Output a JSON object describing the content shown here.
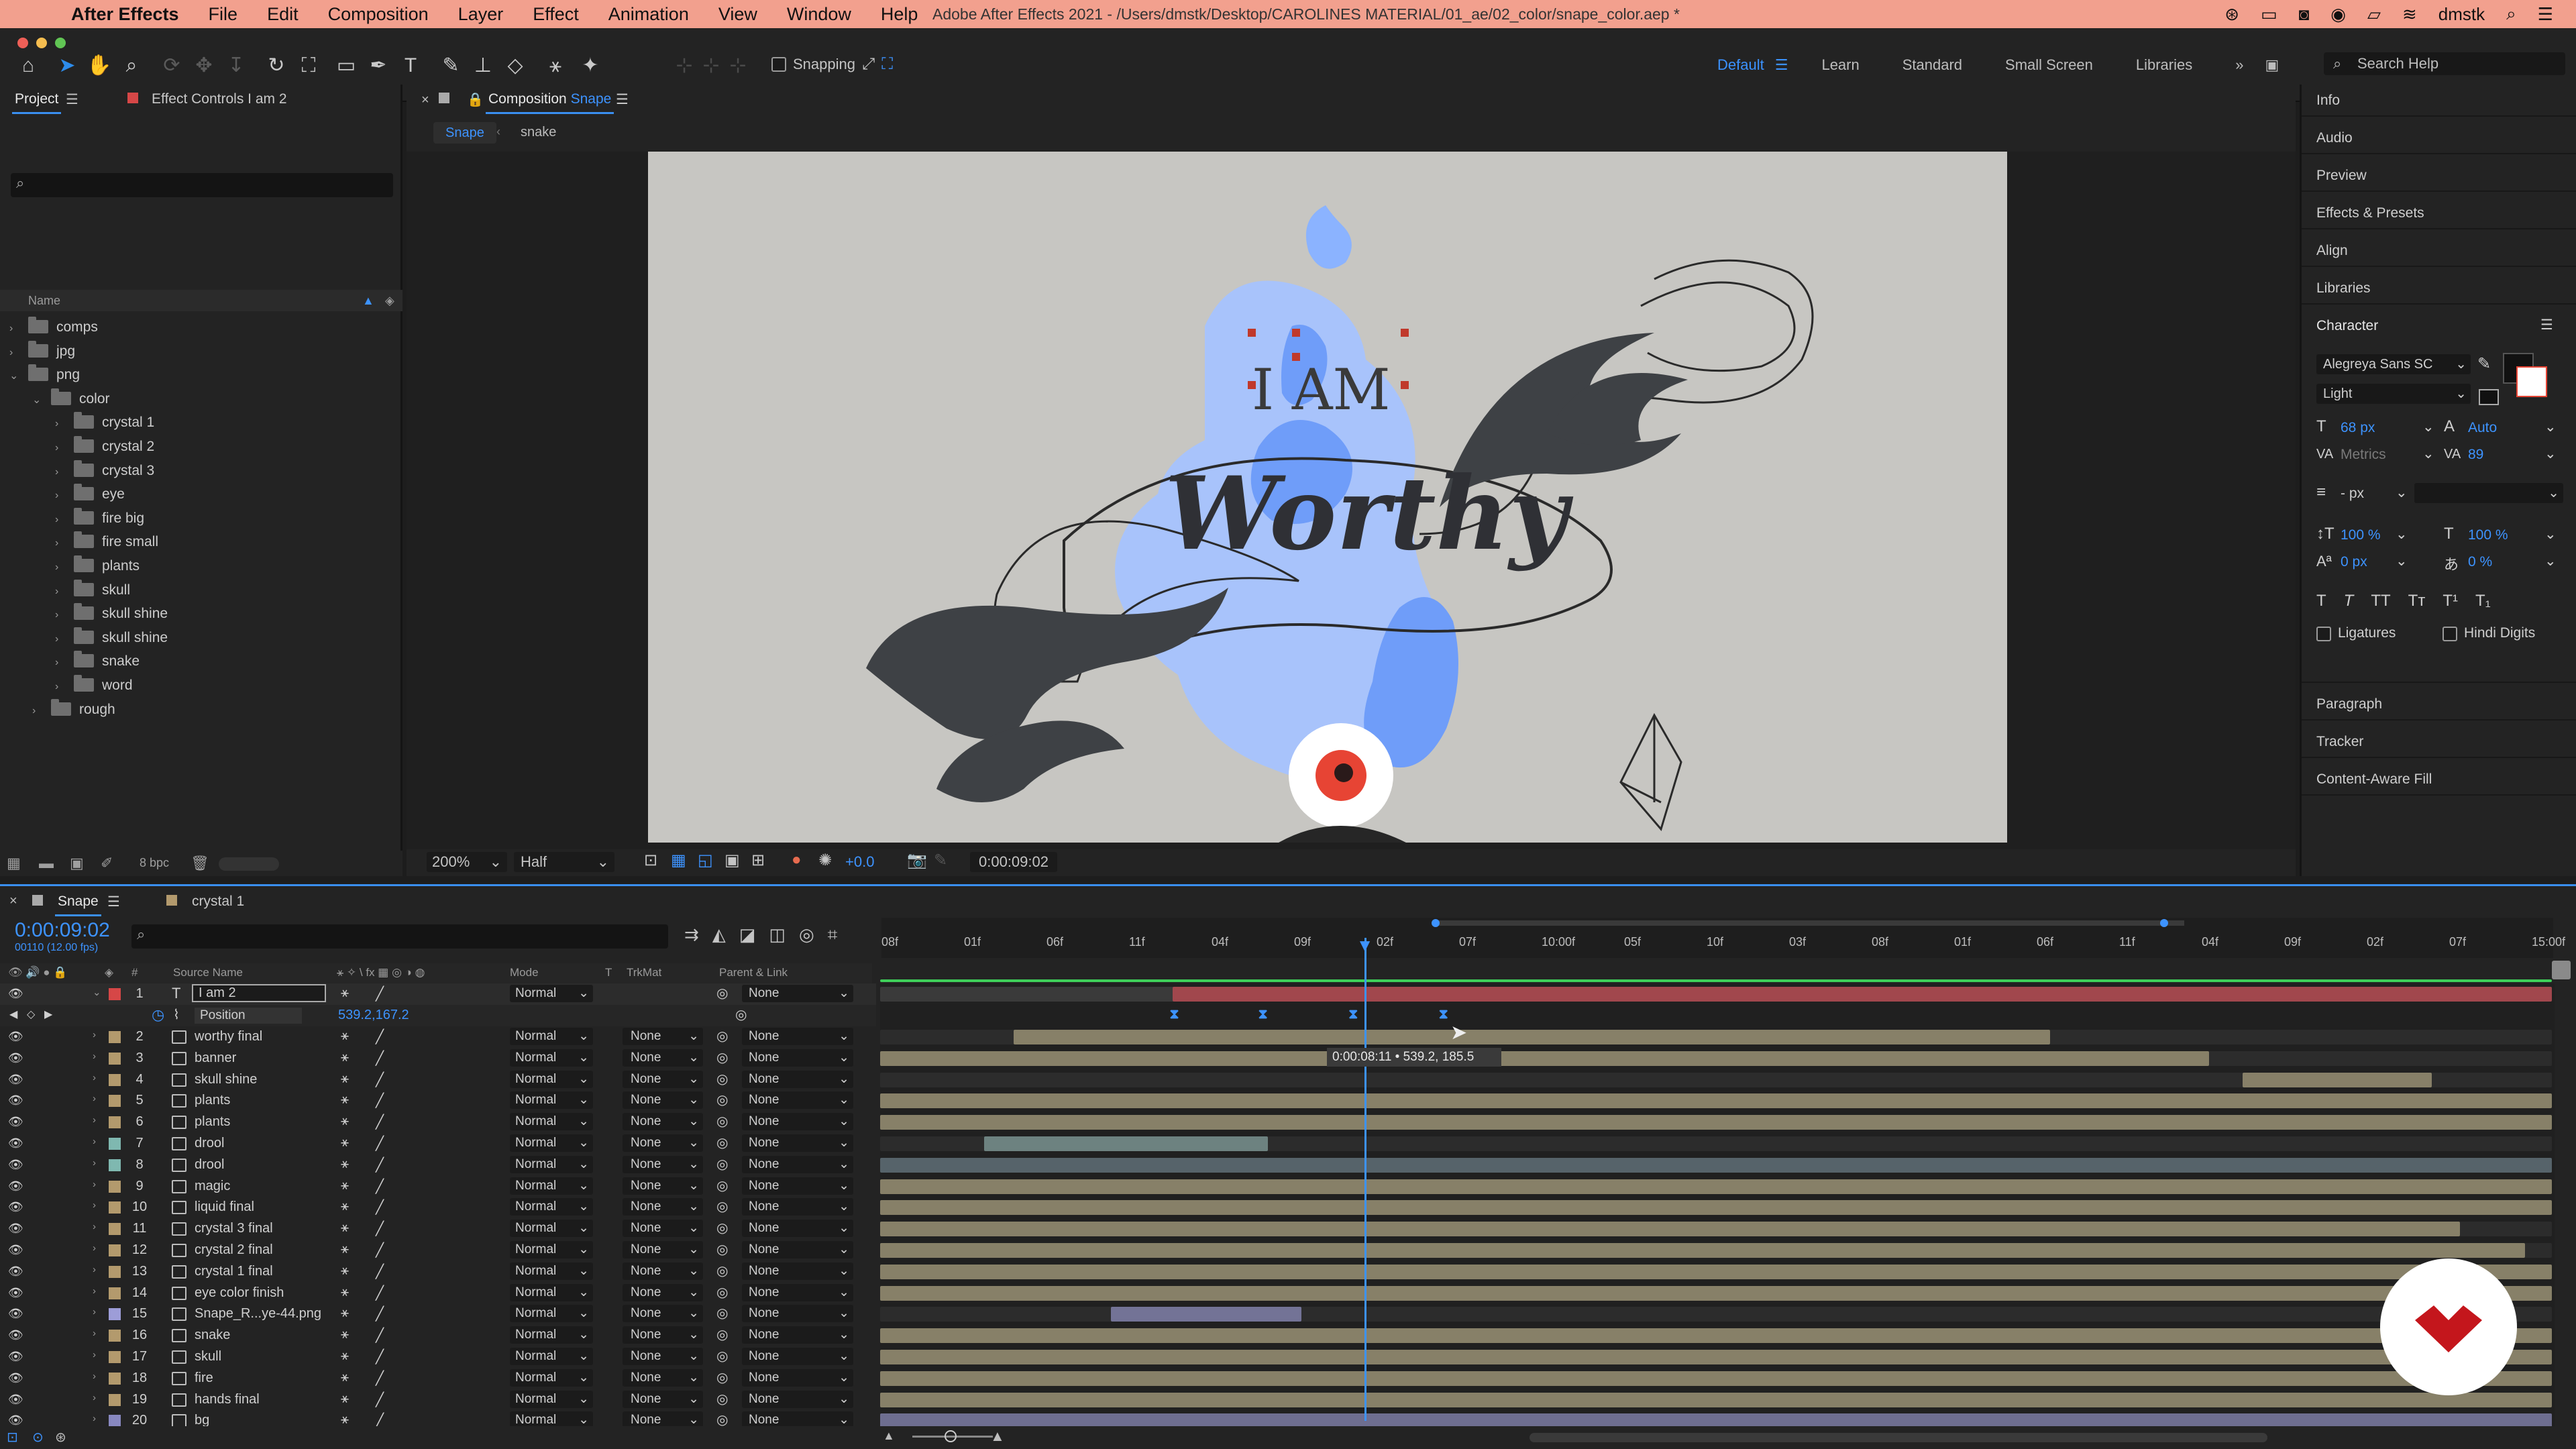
{
  "menubar": {
    "app_name": "After Effects",
    "items": [
      "File",
      "Edit",
      "Composition",
      "Layer",
      "Effect",
      "Animation",
      "View",
      "Window",
      "Help"
    ],
    "window_title": "Adobe After Effects 2021 - /Users/dmstk/Desktop/CAROLINES MATERIAL/01_ae/02_color/snape_color.aep *",
    "user": "dmstk"
  },
  "toolbar": {
    "snapping_label": "Snapping",
    "workspaces": [
      "Default",
      "Learn",
      "Standard",
      "Small Screen",
      "Libraries"
    ],
    "active_workspace": "Default",
    "search_placeholder": "Search Help"
  },
  "project_panel": {
    "tab_project": "Project",
    "tab_effect_controls": "Effect Controls I am 2",
    "column_name": "Name",
    "tree": [
      {
        "label": "comps",
        "depth": 0,
        "open": false
      },
      {
        "label": "jpg",
        "depth": 0,
        "open": false
      },
      {
        "label": "png",
        "depth": 0,
        "open": true
      },
      {
        "label": "color",
        "depth": 1,
        "open": true
      },
      {
        "label": "crystal 1",
        "depth": 2,
        "open": false
      },
      {
        "label": "crystal 2",
        "depth": 2,
        "open": false
      },
      {
        "label": "crystal 3",
        "depth": 2,
        "open": false
      },
      {
        "label": "eye",
        "depth": 2,
        "open": false
      },
      {
        "label": "fire big",
        "depth": 2,
        "open": false
      },
      {
        "label": "fire small",
        "depth": 2,
        "open": false
      },
      {
        "label": "plants",
        "depth": 2,
        "open": false
      },
      {
        "label": "skull",
        "depth": 2,
        "open": false
      },
      {
        "label": "skull shine",
        "depth": 2,
        "open": false
      },
      {
        "label": "skull shine",
        "depth": 2,
        "open": false
      },
      {
        "label": "snake",
        "depth": 2,
        "open": false
      },
      {
        "label": "word",
        "depth": 2,
        "open": false
      },
      {
        "label": "rough",
        "depth": 1,
        "open": false
      }
    ],
    "bpc": "8 bpc"
  },
  "composition_panel": {
    "tab_label": "Composition",
    "tab_comp_name": "Snape",
    "breadcrumbs": [
      "Snape",
      "snake"
    ],
    "zoom": "200%",
    "resolution": "Half",
    "exposure": "+0.0",
    "timecode": "0:00:09:02",
    "canvas_text_top": "I AM",
    "canvas_text_main": "Worthy"
  },
  "right_panel": {
    "sections_top": [
      "Info",
      "Audio",
      "Preview",
      "Effects & Presets",
      "Align",
      "Libraries"
    ],
    "character": {
      "title": "Character",
      "font_family": "Alegreya Sans SC",
      "font_style": "Light",
      "font_size": "68 px",
      "leading": "Auto",
      "kerning": "Metrics",
      "tracking": "89",
      "stroke_width": "- px",
      "vert_scale": "100 %",
      "horiz_scale": "100 %",
      "baseline_shift": "0 px",
      "tsume": "0 %",
      "ligatures_label": "Ligatures",
      "hindi_digits_label": "Hindi Digits"
    },
    "sections_bottom": [
      "Paragraph",
      "Tracker",
      "Content-Aware Fill"
    ]
  },
  "timeline": {
    "tab_snape": "Snape",
    "tab_crystal": "crystal 1",
    "current_time": "0:00:09:02",
    "frame_info": "00110 (12.00 fps)",
    "columns": {
      "source_name": "Source Name",
      "mode": "Mode",
      "t": "T",
      "trkmat": "TrkMat",
      "parent": "Parent & Link"
    },
    "ruler_ticks": [
      "08f",
      "01f",
      "06f",
      "11f",
      "04f",
      "09f",
      "02f",
      "07f",
      "10:00f",
      "05f",
      "10f",
      "03f",
      "08f",
      "01f",
      "06f",
      "11f",
      "04f",
      "09f",
      "02f",
      "07f",
      "15:00f"
    ],
    "property": {
      "name": "Position",
      "value": "539.2,167.2"
    },
    "tooltip": "0:00:08:11 • 539.2, 185.5",
    "layers": [
      {
        "num": "1",
        "name": "I am 2",
        "type": "text",
        "mode": "Normal",
        "trkmat": "",
        "parent": "None",
        "color": "#d64747",
        "bar_start": 0.175,
        "bar_end": 1.0,
        "bar_color": "#a1474d"
      },
      {
        "num": "2",
        "name": "worthy final",
        "type": "img",
        "mode": "Normal",
        "trkmat": "None",
        "parent": "None",
        "color": "#b39a6d",
        "bar_start": 0.08,
        "bar_end": 0.7,
        "bar_color": "#878068"
      },
      {
        "num": "3",
        "name": "banner",
        "type": "img",
        "mode": "Normal",
        "trkmat": "None",
        "parent": "None",
        "color": "#b39a6d",
        "bar_start": 0.0,
        "bar_end": 0.795,
        "bar_color": "#878068"
      },
      {
        "num": "4",
        "name": "skull shine",
        "type": "img",
        "mode": "Normal",
        "trkmat": "None",
        "parent": "None",
        "color": "#b39a6d",
        "bar_start": 0.815,
        "bar_end": 0.928,
        "bar_color": "#878068"
      },
      {
        "num": "5",
        "name": "plants",
        "type": "img",
        "mode": "Normal",
        "trkmat": "None",
        "parent": "None",
        "color": "#b39a6d",
        "bar_start": 0.0,
        "bar_end": 1.0,
        "bar_color": "#878068"
      },
      {
        "num": "6",
        "name": "plants",
        "type": "img",
        "mode": "Normal",
        "trkmat": "None",
        "parent": "None",
        "color": "#b39a6d",
        "bar_start": 0.0,
        "bar_end": 1.0,
        "bar_color": "#878068"
      },
      {
        "num": "7",
        "name": "drool",
        "type": "img",
        "mode": "Normal",
        "trkmat": "None",
        "parent": "None",
        "color": "#7fb8b0",
        "bar_start": 0.062,
        "bar_end": 0.232,
        "bar_color": "#6d8280"
      },
      {
        "num": "8",
        "name": "drool",
        "type": "img",
        "mode": "Normal",
        "trkmat": "None",
        "parent": "None",
        "color": "#7fb8b0",
        "bar_start": 0.0,
        "bar_end": 1.0,
        "bar_color": "#56636a"
      },
      {
        "num": "9",
        "name": "magic",
        "type": "img",
        "mode": "Normal",
        "trkmat": "None",
        "parent": "None",
        "color": "#b39a6d",
        "bar_start": 0.0,
        "bar_end": 1.0,
        "bar_color": "#878068"
      },
      {
        "num": "10",
        "name": "liquid final",
        "type": "img",
        "mode": "Normal",
        "trkmat": "None",
        "parent": "None",
        "color": "#b39a6d",
        "bar_start": 0.0,
        "bar_end": 1.0,
        "bar_color": "#878068"
      },
      {
        "num": "11",
        "name": "crystal 3 final",
        "type": "img",
        "mode": "Normal",
        "trkmat": "None",
        "parent": "None",
        "color": "#b39a6d",
        "bar_start": 0.0,
        "bar_end": 0.945,
        "bar_color": "#878068"
      },
      {
        "num": "12",
        "name": "crystal 2 final",
        "type": "img",
        "mode": "Normal",
        "trkmat": "None",
        "parent": "None",
        "color": "#b39a6d",
        "bar_start": 0.0,
        "bar_end": 0.984,
        "bar_color": "#878068"
      },
      {
        "num": "13",
        "name": "crystal 1 final",
        "type": "img",
        "mode": "Normal",
        "trkmat": "None",
        "parent": "None",
        "color": "#b39a6d",
        "bar_start": 0.0,
        "bar_end": 1.0,
        "bar_color": "#878068"
      },
      {
        "num": "14",
        "name": "eye color finish",
        "type": "img",
        "mode": "Normal",
        "trkmat": "None",
        "parent": "None",
        "color": "#b39a6d",
        "bar_start": 0.0,
        "bar_end": 1.0,
        "bar_color": "#878068"
      },
      {
        "num": "15",
        "name": "Snape_R...ye-44.png",
        "type": "png",
        "mode": "Normal",
        "trkmat": "None",
        "parent": "None",
        "color": "#9d9dd8",
        "bar_start": 0.138,
        "bar_end": 0.252,
        "bar_color": "#737396"
      },
      {
        "num": "16",
        "name": "snake",
        "type": "img",
        "mode": "Normal",
        "trkmat": "None",
        "parent": "None",
        "color": "#b39a6d",
        "bar_start": 0.0,
        "bar_end": 1.0,
        "bar_color": "#878068"
      },
      {
        "num": "17",
        "name": "skull",
        "type": "img",
        "mode": "Normal",
        "trkmat": "None",
        "parent": "None",
        "color": "#b39a6d",
        "bar_start": 0.0,
        "bar_end": 1.0,
        "bar_color": "#878068"
      },
      {
        "num": "18",
        "name": "fire",
        "type": "img",
        "mode": "Normal",
        "trkmat": "None",
        "parent": "None",
        "color": "#b39a6d",
        "bar_start": 0.0,
        "bar_end": 1.0,
        "bar_color": "#878068"
      },
      {
        "num": "19",
        "name": "hands final",
        "type": "img",
        "mode": "Normal",
        "trkmat": "None",
        "parent": "None",
        "color": "#b39a6d",
        "bar_start": 0.0,
        "bar_end": 1.0,
        "bar_color": "#878068"
      },
      {
        "num": "20",
        "name": "bg",
        "type": "img",
        "mode": "Normal",
        "trkmat": "None",
        "parent": "None",
        "color": "#8888c0",
        "bar_start": 0.0,
        "bar_end": 1.0,
        "bar_color": "#6e6e90"
      }
    ],
    "playhead_fraction": 0.29,
    "keyframe_fractions": [
      0.176,
      0.229,
      0.283,
      0.337
    ]
  },
  "colors": {
    "accent": "#3d93ff",
    "menubar": "#f2a08e",
    "panel": "#232323"
  }
}
